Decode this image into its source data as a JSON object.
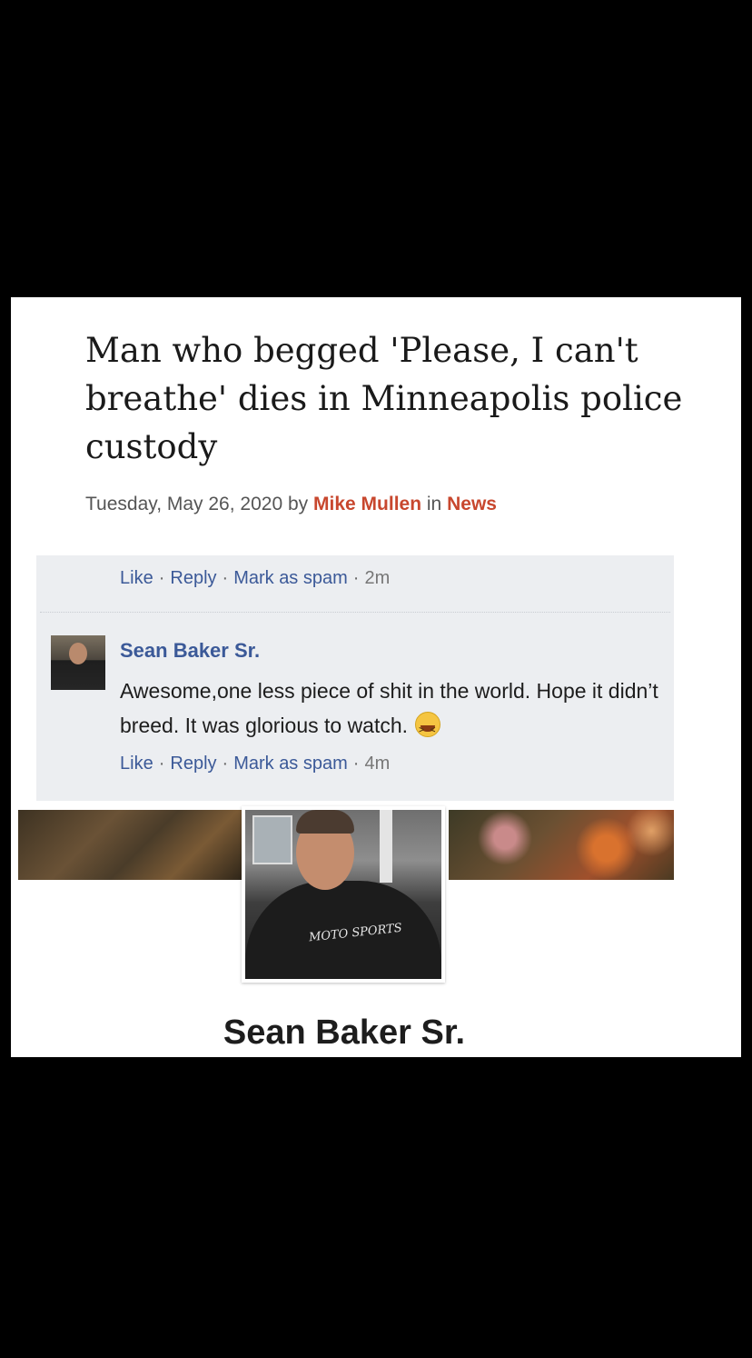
{
  "article": {
    "headline": "Man who begged 'Please, I can't breathe' dies in Minneapolis police custody",
    "date": "Tuesday, May 26, 2020",
    "by_word": "by",
    "author": "Mike Mullen",
    "in_word": "in",
    "section": "News"
  },
  "comments": {
    "previous_actions": {
      "like": "Like",
      "reply": "Reply",
      "spam": "Mark as spam",
      "separator": "·",
      "time": "2m"
    },
    "comment": {
      "author": "Sean Baker Sr.",
      "text": "Awesome,one less piece of shit in the world. Hope it didn’t breed. It was glorious to watch.",
      "emoji_icon": "grinning-squinting-face-icon",
      "actions": {
        "like": "Like",
        "reply": "Reply",
        "spam": "Mark as spam",
        "separator": "·",
        "time": "4m"
      }
    }
  },
  "profile": {
    "name": "Sean Baker Sr.",
    "shirt_logo": "MOTO SPORTS"
  },
  "colors": {
    "link_blue": "#3b5998",
    "byline_red": "#c8472e",
    "comment_bg": "#eceef1",
    "page_bg": "#000000"
  }
}
